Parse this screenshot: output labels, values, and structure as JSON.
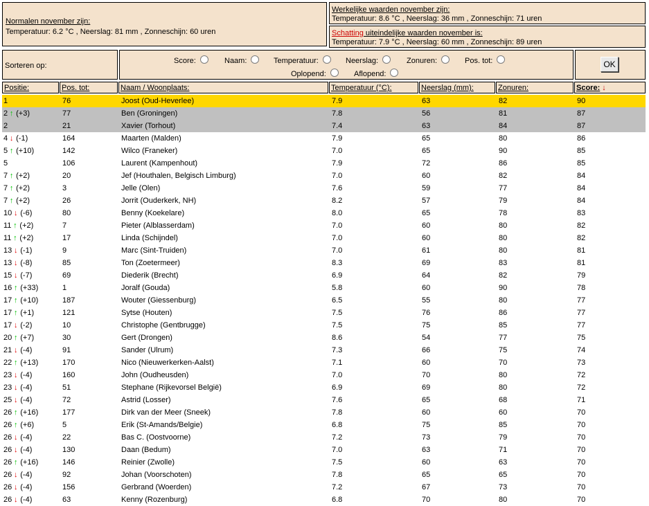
{
  "normals": {
    "title": "Normalen november zijn:",
    "text": "Temperatuur: 6.2 °C , Neerslag: 81 mm , Zonneschijn: 60 uren"
  },
  "actual": {
    "title": "Werkelijke waarden november zijn:",
    "text": "Temperatuur: 8.6 °C , Neerslag: 36 mm , Zonneschijn: 71 uren"
  },
  "estimate": {
    "title_red": "Schatting",
    "title_rest": " uiteindelijke waarden november is:",
    "text": "Temperatuur: 7.9 °C , Neerslag: 60 mm , Zonneschijn: 89 uren"
  },
  "sort": {
    "label": "Sorteren op:",
    "options": [
      "Score:",
      "Naam:",
      "Temperatuur:",
      "Neerslag:",
      "Zonuren:",
      "Pos. tot:"
    ],
    "order": [
      "Oplopend:",
      "Aflopend:"
    ],
    "ok": "OK"
  },
  "columns": [
    "Positie:",
    "Pos. tot:",
    "Naam / Woonplaats:",
    "Temperatuur (°C):",
    "Neerslag (mm):",
    "Zonuren:",
    "Score:"
  ],
  "colors": {
    "panel": "#f4e2cc",
    "leader": "#ffd700",
    "podium": "#c0c0c0",
    "up": "#00c000",
    "down": "#e00000"
  },
  "rows": [
    {
      "pos": "1",
      "dir": "",
      "change": "",
      "tot": "76",
      "name": "Joost (Oud-Heverlee)",
      "temp": "7.9",
      "rain": "63",
      "sun": "82",
      "score": "90",
      "hl": "gold"
    },
    {
      "pos": "2",
      "dir": "up",
      "change": "(+3)",
      "tot": "77",
      "name": "Ben (Groningen)",
      "temp": "7.8",
      "rain": "56",
      "sun": "81",
      "score": "87",
      "hl": "grey"
    },
    {
      "pos": "2",
      "dir": "",
      "change": "",
      "tot": "21",
      "name": "Xavier (Torhout)",
      "temp": "7.4",
      "rain": "63",
      "sun": "84",
      "score": "87",
      "hl": "grey"
    },
    {
      "pos": "4",
      "dir": "down",
      "change": "(-1)",
      "tot": "164",
      "name": "Maarten (Malden)",
      "temp": "7.9",
      "rain": "65",
      "sun": "80",
      "score": "86",
      "hl": ""
    },
    {
      "pos": "5",
      "dir": "up",
      "change": "(+10)",
      "tot": "142",
      "name": "Wilco (Franeker)",
      "temp": "7.0",
      "rain": "65",
      "sun": "90",
      "score": "85",
      "hl": ""
    },
    {
      "pos": "5",
      "dir": "",
      "change": "",
      "tot": "106",
      "name": "Laurent (Kampenhout)",
      "temp": "7.9",
      "rain": "72",
      "sun": "86",
      "score": "85",
      "hl": ""
    },
    {
      "pos": "7",
      "dir": "up",
      "change": "(+2)",
      "tot": "20",
      "name": "Jef (Houthalen, Belgisch Limburg)",
      "temp": "7.0",
      "rain": "60",
      "sun": "82",
      "score": "84",
      "hl": ""
    },
    {
      "pos": "7",
      "dir": "up",
      "change": "(+2)",
      "tot": "3",
      "name": "Jelle (Olen)",
      "temp": "7.6",
      "rain": "59",
      "sun": "77",
      "score": "84",
      "hl": ""
    },
    {
      "pos": "7",
      "dir": "up",
      "change": "(+2)",
      "tot": "26",
      "name": "Jorrit (Ouderkerk, NH)",
      "temp": "8.2",
      "rain": "57",
      "sun": "79",
      "score": "84",
      "hl": ""
    },
    {
      "pos": "10",
      "dir": "down",
      "change": "(-6)",
      "tot": "80",
      "name": "Benny (Koekelare)",
      "temp": "8.0",
      "rain": "65",
      "sun": "78",
      "score": "83",
      "hl": ""
    },
    {
      "pos": "11",
      "dir": "up",
      "change": "(+2)",
      "tot": "7",
      "name": "Pieter (Alblasserdam)",
      "temp": "7.0",
      "rain": "60",
      "sun": "80",
      "score": "82",
      "hl": ""
    },
    {
      "pos": "11",
      "dir": "up",
      "change": "(+2)",
      "tot": "17",
      "name": "Linda (Schijndel)",
      "temp": "7.0",
      "rain": "60",
      "sun": "80",
      "score": "82",
      "hl": ""
    },
    {
      "pos": "13",
      "dir": "down",
      "change": "(-1)",
      "tot": "9",
      "name": "Marc (Sint-Truiden)",
      "temp": "7.0",
      "rain": "61",
      "sun": "80",
      "score": "81",
      "hl": ""
    },
    {
      "pos": "13",
      "dir": "down",
      "change": "(-8)",
      "tot": "85",
      "name": "Ton (Zoetermeer)",
      "temp": "8.3",
      "rain": "69",
      "sun": "83",
      "score": "81",
      "hl": ""
    },
    {
      "pos": "15",
      "dir": "down",
      "change": "(-7)",
      "tot": "69",
      "name": "Diederik (Brecht)",
      "temp": "6.9",
      "rain": "64",
      "sun": "82",
      "score": "79",
      "hl": ""
    },
    {
      "pos": "16",
      "dir": "up",
      "change": "(+33)",
      "tot": "1",
      "name": "Joralf (Gouda)",
      "temp": "5.8",
      "rain": "60",
      "sun": "90",
      "score": "78",
      "hl": ""
    },
    {
      "pos": "17",
      "dir": "up",
      "change": "(+10)",
      "tot": "187",
      "name": "Wouter (Giessenburg)",
      "temp": "6.5",
      "rain": "55",
      "sun": "80",
      "score": "77",
      "hl": ""
    },
    {
      "pos": "17",
      "dir": "up",
      "change": "(+1)",
      "tot": "121",
      "name": "Sytse (Houten)",
      "temp": "7.5",
      "rain": "76",
      "sun": "86",
      "score": "77",
      "hl": ""
    },
    {
      "pos": "17",
      "dir": "down",
      "change": "(-2)",
      "tot": "10",
      "name": "Christophe (Gentbrugge)",
      "temp": "7.5",
      "rain": "75",
      "sun": "85",
      "score": "77",
      "hl": ""
    },
    {
      "pos": "20",
      "dir": "up",
      "change": "(+7)",
      "tot": "30",
      "name": "Gert (Drongen)",
      "temp": "8.6",
      "rain": "54",
      "sun": "77",
      "score": "75",
      "hl": ""
    },
    {
      "pos": "21",
      "dir": "down",
      "change": "(-4)",
      "tot": "91",
      "name": "Sander (Ulrum)",
      "temp": "7.3",
      "rain": "66",
      "sun": "75",
      "score": "74",
      "hl": ""
    },
    {
      "pos": "22",
      "dir": "up",
      "change": "(+13)",
      "tot": "170",
      "name": "Nico (Nieuwerkerken-Aalst)",
      "temp": "7.1",
      "rain": "60",
      "sun": "70",
      "score": "73",
      "hl": ""
    },
    {
      "pos": "23",
      "dir": "down",
      "change": "(-4)",
      "tot": "160",
      "name": "John (Oudheusden)",
      "temp": "7.0",
      "rain": "70",
      "sun": "80",
      "score": "72",
      "hl": ""
    },
    {
      "pos": "23",
      "dir": "down",
      "change": "(-4)",
      "tot": "51",
      "name": "Stephane (Rijkevorsel België)",
      "temp": "6.9",
      "rain": "69",
      "sun": "80",
      "score": "72",
      "hl": ""
    },
    {
      "pos": "25",
      "dir": "down",
      "change": "(-4)",
      "tot": "72",
      "name": "Astrid (Losser)",
      "temp": "7.6",
      "rain": "65",
      "sun": "68",
      "score": "71",
      "hl": ""
    },
    {
      "pos": "26",
      "dir": "up",
      "change": "(+16)",
      "tot": "177",
      "name": "Dirk van der Meer (Sneek)",
      "temp": "7.8",
      "rain": "60",
      "sun": "60",
      "score": "70",
      "hl": ""
    },
    {
      "pos": "26",
      "dir": "up",
      "change": "(+6)",
      "tot": "5",
      "name": "Erik (St-Amands/Belgie)",
      "temp": "6.8",
      "rain": "75",
      "sun": "85",
      "score": "70",
      "hl": ""
    },
    {
      "pos": "26",
      "dir": "down",
      "change": "(-4)",
      "tot": "22",
      "name": "Bas C. (Oostvoorne)",
      "temp": "7.2",
      "rain": "73",
      "sun": "79",
      "score": "70",
      "hl": ""
    },
    {
      "pos": "26",
      "dir": "down",
      "change": "(-4)",
      "tot": "130",
      "name": "Daan (Bedum)",
      "temp": "7.0",
      "rain": "63",
      "sun": "71",
      "score": "70",
      "hl": ""
    },
    {
      "pos": "26",
      "dir": "up",
      "change": "(+16)",
      "tot": "146",
      "name": "Reinier (Zwolle)",
      "temp": "7.5",
      "rain": "60",
      "sun": "63",
      "score": "70",
      "hl": ""
    },
    {
      "pos": "26",
      "dir": "down",
      "change": "(-4)",
      "tot": "92",
      "name": "Johan (Voorschoten)",
      "temp": "7.8",
      "rain": "65",
      "sun": "65",
      "score": "70",
      "hl": ""
    },
    {
      "pos": "26",
      "dir": "down",
      "change": "(-4)",
      "tot": "156",
      "name": "Gerbrand (Woerden)",
      "temp": "7.2",
      "rain": "67",
      "sun": "73",
      "score": "70",
      "hl": ""
    },
    {
      "pos": "26",
      "dir": "down",
      "change": "(-4)",
      "tot": "63",
      "name": "Kenny (Rozenburg)",
      "temp": "6.8",
      "rain": "70",
      "sun": "80",
      "score": "70",
      "hl": ""
    }
  ]
}
